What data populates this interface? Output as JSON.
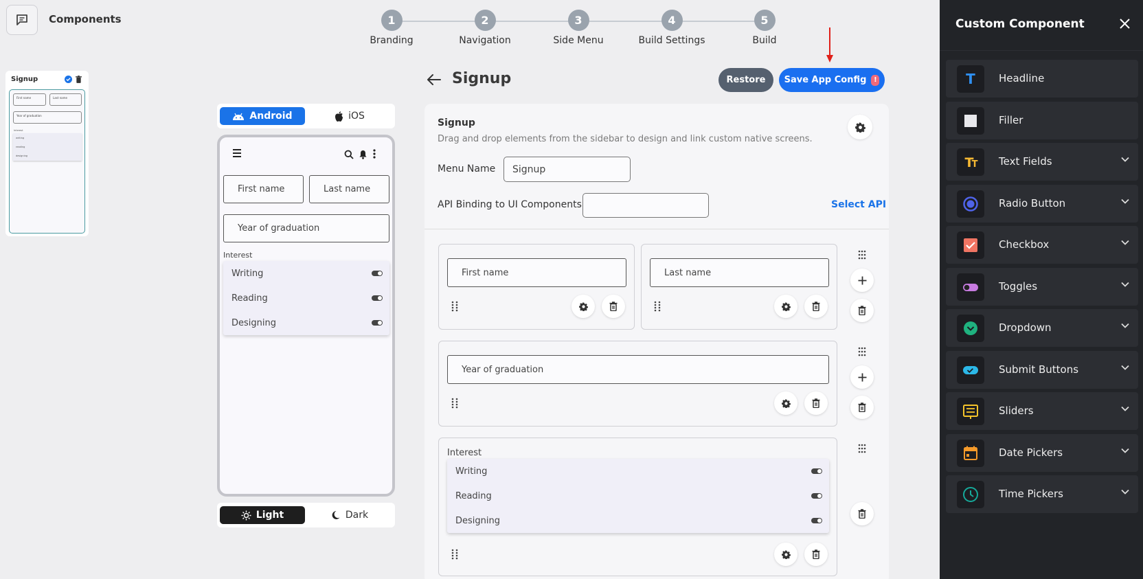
{
  "top_left": {
    "title": "Components",
    "icon": "chat-icon"
  },
  "thumbnail": {
    "title": "Signup",
    "first_name": "First name",
    "last_name": "Last name",
    "year": "Year of graduation",
    "interest": "Interest",
    "rows": [
      "writing",
      "reading",
      "designing"
    ]
  },
  "stepper": {
    "steps": [
      {
        "number": "1",
        "label": "Branding"
      },
      {
        "number": "2",
        "label": "Navigation"
      },
      {
        "number": "3",
        "label": "Side Menu"
      },
      {
        "number": "4",
        "label": "Build Settings"
      },
      {
        "number": "5",
        "label": "Build"
      }
    ]
  },
  "header": {
    "title": "Signup",
    "restore_label": "Restore",
    "save_label": "Save App Config",
    "save_badge": "!"
  },
  "platform": {
    "android": "Android",
    "ios": "iOS",
    "selected": "Android"
  },
  "theme": {
    "light": "Light",
    "dark": "Dark",
    "selected": "Light"
  },
  "phone": {
    "first_name": "First name",
    "last_name": "Last name",
    "year": "Year of graduation",
    "interest": "Interest",
    "rows": [
      "Writing",
      "Reading",
      "Designing"
    ]
  },
  "editor": {
    "title": "Signup",
    "subtitle": "Drag and drop elements from the sidebar to design and link custom native screens.",
    "menu_name_label": "Menu Name",
    "menu_name_value": "Signup",
    "api_label": "API Binding to UI Components",
    "api_value": "",
    "select_api": "Select API",
    "first_name": "First name",
    "last_name": "Last name",
    "year": "Year of graduation",
    "interest": "Interest",
    "rows": [
      "Writing",
      "Reading",
      "Designing"
    ]
  },
  "panel": {
    "title": "Custom Component",
    "items": [
      {
        "label": "Headline",
        "icon": "headline-icon",
        "color": "#2f8ff0"
      },
      {
        "label": "Filler",
        "icon": "filler-icon",
        "color": "#e8e8ec"
      },
      {
        "label": "Text Fields",
        "icon": "text-fields-icon",
        "color": "#f5b833"
      },
      {
        "label": "Radio Button",
        "icon": "radio-icon",
        "color": "#4f63e8"
      },
      {
        "label": "Checkbox",
        "icon": "checkbox-icon",
        "color": "#f07563"
      },
      {
        "label": "Toggles",
        "icon": "toggle-icon",
        "color": "#c77be0"
      },
      {
        "label": "Dropdown",
        "icon": "dropdown-icon",
        "color": "#1fb27f"
      },
      {
        "label": "Submit Buttons",
        "icon": "submit-icon",
        "color": "#2cb8e8"
      },
      {
        "label": "Sliders",
        "icon": "sliders-icon",
        "color": "#f5c42a"
      },
      {
        "label": "Date Pickers",
        "icon": "calendar-icon",
        "color": "#f59a2a"
      },
      {
        "label": "Time Pickers",
        "icon": "clock-icon",
        "color": "#16a99a"
      }
    ]
  },
  "colors": {
    "accent": "#1a73e8",
    "panel_bg": "#222428",
    "restore": "#55606f"
  }
}
